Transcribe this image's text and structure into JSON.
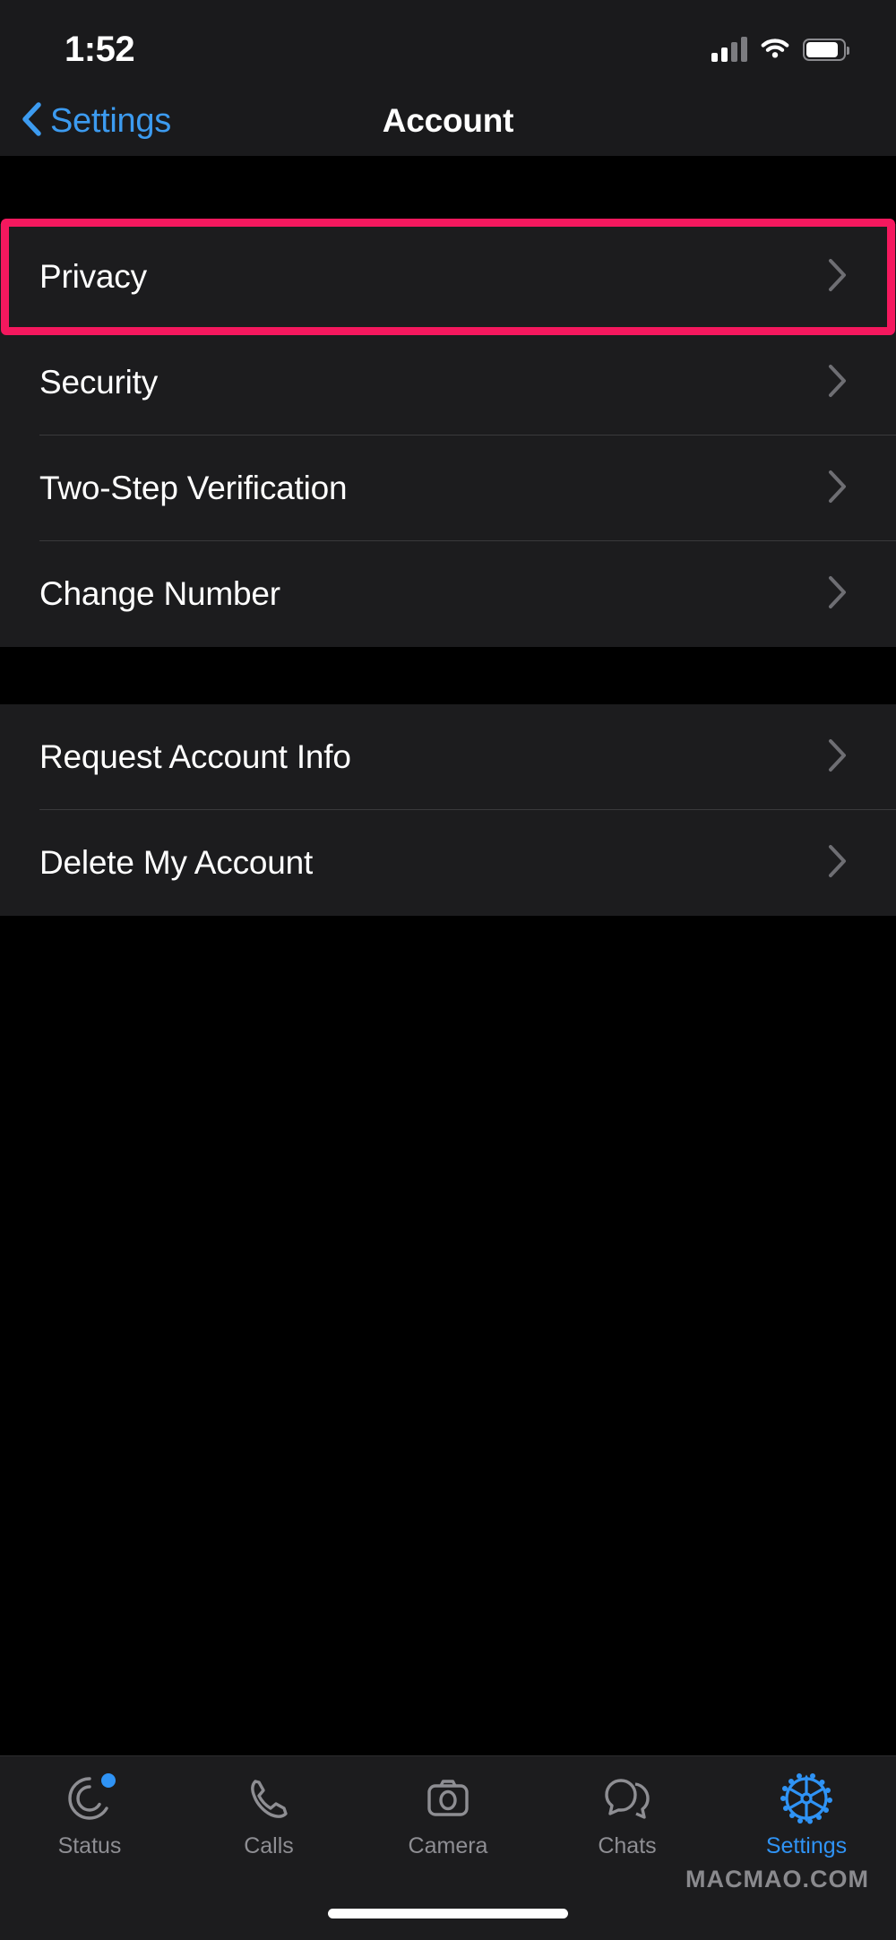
{
  "status_bar": {
    "time": "1:52",
    "cellular_icon": "cellular-signal-icon",
    "wifi_icon": "wifi-icon",
    "battery_icon": "battery-icon"
  },
  "nav_bar": {
    "back_label": "Settings",
    "back_icon": "chevron-left-icon",
    "title": "Account"
  },
  "colors": {
    "accent_blue": "#3c9bf0",
    "highlight_pink": "#f4185e",
    "row_bg": "#1c1c1e",
    "page_bg": "#000000",
    "separator": "#3a3a3c",
    "inactive_tab": "#8e8e93"
  },
  "sections": [
    {
      "rows": [
        {
          "label": "Privacy",
          "chevron": "chevron-right-icon",
          "highlighted": true
        },
        {
          "label": "Security",
          "chevron": "chevron-right-icon",
          "highlighted": false
        },
        {
          "label": "Two-Step Verification",
          "chevron": "chevron-right-icon",
          "highlighted": false
        },
        {
          "label": "Change Number",
          "chevron": "chevron-right-icon",
          "highlighted": false
        }
      ]
    },
    {
      "rows": [
        {
          "label": "Request Account Info",
          "chevron": "chevron-right-icon",
          "highlighted": false
        },
        {
          "label": "Delete My Account",
          "chevron": "chevron-right-icon",
          "highlighted": false
        }
      ]
    }
  ],
  "tab_bar": {
    "items": [
      {
        "label": "Status",
        "icon": "status-rings-icon",
        "active": false,
        "badge": true
      },
      {
        "label": "Calls",
        "icon": "phone-icon",
        "active": false,
        "badge": false
      },
      {
        "label": "Camera",
        "icon": "camera-icon",
        "active": false,
        "badge": false
      },
      {
        "label": "Chats",
        "icon": "chat-bubbles-icon",
        "active": false,
        "badge": false
      },
      {
        "label": "Settings",
        "icon": "gear-icon",
        "active": true,
        "badge": false
      }
    ]
  },
  "watermark": {
    "text": "MACMAO.COM"
  }
}
